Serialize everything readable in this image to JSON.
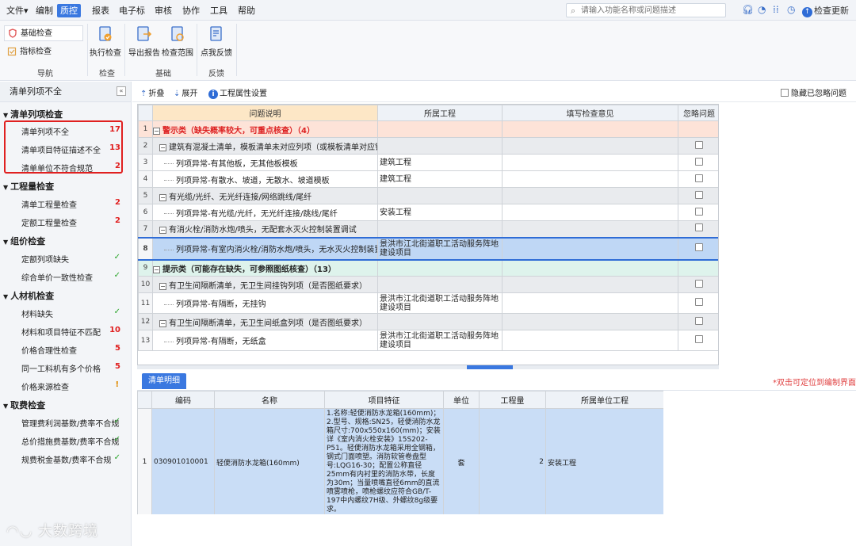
{
  "menu": {
    "items": [
      {
        "label": "文件",
        "suffix": "▾"
      },
      {
        "label": "编制"
      },
      {
        "label": "质控"
      },
      {
        "label": "报表"
      },
      {
        "label": "电子标"
      },
      {
        "label": "审核"
      },
      {
        "label": "协作"
      },
      {
        "label": "工具"
      },
      {
        "label": "帮助"
      }
    ],
    "active": "质控",
    "search_placeholder": "请输入功能名称或问题描述",
    "update_label": "检查更新"
  },
  "ribbon": {
    "nav": {
      "basic_check": "基础检查",
      "indicator_check": "指标检查",
      "group_label": "导航"
    },
    "check": {
      "run": "执行检查",
      "group_label": "检查"
    },
    "basic": {
      "export": "导出报告",
      "scope": "检查范围",
      "group_label": "基础"
    },
    "feedback": {
      "point": "点我反馈",
      "group_label": "反馈"
    }
  },
  "left_panel": {
    "title": "清单列项不全",
    "groups": [
      {
        "label": "清单列项检查",
        "items": [
          {
            "label": "清单列项不全",
            "count": "17"
          },
          {
            "label": "清单项目特征描述不全",
            "count": "13"
          },
          {
            "label": "清单单位不符合规范",
            "count": "2"
          }
        ]
      },
      {
        "label": "工程量检查",
        "items": [
          {
            "label": "清单工程量检查",
            "count": "2"
          },
          {
            "label": "定额工程量检查",
            "count": "2"
          }
        ]
      },
      {
        "label": "组价检查",
        "items": [
          {
            "label": "定额列项缺失",
            "status": "ok"
          },
          {
            "label": "综合单价一致性检查",
            "status": "ok"
          }
        ]
      },
      {
        "label": "人材机检查",
        "items": [
          {
            "label": "材料缺失",
            "status": "ok"
          },
          {
            "label": "材料和项目特征不匹配",
            "count": "10"
          },
          {
            "label": "价格合理性检查",
            "count": "5"
          },
          {
            "label": "同一工料机有多个价格",
            "count": "5"
          },
          {
            "label": "价格来源检查",
            "status": "warn"
          }
        ]
      },
      {
        "label": "取费检查",
        "items": [
          {
            "label": "管理费利润基数/费率不合规",
            "status": "ok"
          },
          {
            "label": "总价措施费基数/费率不合规",
            "status": "ok"
          },
          {
            "label": "规费税金基数/费率不合规",
            "status": "ok"
          }
        ]
      }
    ]
  },
  "toolbar": {
    "collapse": "折叠",
    "expand": "展开",
    "settings": "工程属性设置",
    "hide_ignored": "隐藏已忽略问题"
  },
  "grid": {
    "headers": [
      "问题说明",
      "所属工程",
      "填写检查意见",
      "忽略问题"
    ],
    "rows": [
      {
        "n": "1",
        "kind": "cat-a",
        "text": "警示类（缺失概率较大，可重点核查）（4）",
        "project": "",
        "cb": false
      },
      {
        "n": "2",
        "kind": "grp",
        "text": "建筑有混凝土清单，模板清单未对应列项（或模板清单对应错误）",
        "project": "",
        "cb": true
      },
      {
        "n": "3",
        "kind": "leaf",
        "text": "列项异常-有其他板，无其他板模板",
        "project": "建筑工程",
        "cb": true
      },
      {
        "n": "4",
        "kind": "leaf",
        "text": "列项异常-有散水、坡道，无散水、坡道模板",
        "project": "建筑工程",
        "cb": true
      },
      {
        "n": "5",
        "kind": "grp",
        "text": "有光缆/光纤、无光纤连接/网络跳线/尾纤",
        "project": "",
        "cb": true
      },
      {
        "n": "6",
        "kind": "leaf",
        "text": "列项异常-有光缆/光纤，无光纤连接/跳线/尾纤",
        "project": "安装工程",
        "cb": true
      },
      {
        "n": "7",
        "kind": "grp",
        "text": "有消火栓/消防水炮/喷头，无配套水灭火控制装置调试",
        "project": "",
        "cb": true
      },
      {
        "n": "8",
        "kind": "sel",
        "text": "列项异常-有室内消火栓/消防水炮/喷头，无水灭火控制装置调试",
        "project": "景洪市江北街道职工活动服务阵地建设项目",
        "cb": true
      },
      {
        "n": "9",
        "kind": "cat-b",
        "text": "提示类（可能存在缺失，可参照图纸核查）（13）",
        "project": "",
        "cb": false
      },
      {
        "n": "10",
        "kind": "grp",
        "text": "有卫生间隔断清单，无卫生间挂钩列项（是否图纸要求）",
        "project": "",
        "cb": true
      },
      {
        "n": "11",
        "kind": "leaf",
        "text": "列项异常-有隔断，无挂钩",
        "project": "景洪市江北街道职工活动服务阵地建设项目",
        "cb": true
      },
      {
        "n": "12",
        "kind": "grp",
        "text": "有卫生间隔断清单，无卫生间纸盒列项（是否图纸要求）",
        "project": "",
        "cb": true
      },
      {
        "n": "13",
        "kind": "leaf",
        "text": "列项异常-有隔断，无纸盒",
        "project": "景洪市江北街道职工活动服务阵地建设项目",
        "cb": true
      }
    ]
  },
  "bottom": {
    "tab": "清单明细",
    "hint": "*双击可定位到编制界面",
    "headers": [
      "编码",
      "名称",
      "项目特征",
      "单位",
      "工程量",
      "所属单位工程"
    ],
    "rows": [
      {
        "n": "1",
        "code": "030901010001",
        "name": "轻便消防水龙箱(160mm)",
        "feature": "1.名称:轻便消防水龙箱(160mm)；2.型号、规格:SN25，轻便消防水龙箱尺寸:700x550x160(mm)；安装详《室内消火栓安装》15S202-P51。轻便消防水龙箱采用全钢箱，钢式门面喷塑。消防软管卷盘型号:LQG16-30；配置公称直径25mm有内衬里的消防水带，长度为30m；当量喷嘴直径6mm的直流喷雾喷枪，喷枪螺纹应符合GB/T-197中内螺纹7H级、外螺纹8g级要求。",
        "unit": "套",
        "qty": "2",
        "project": "安装工程"
      }
    ]
  },
  "watermark": "大数跨境"
}
